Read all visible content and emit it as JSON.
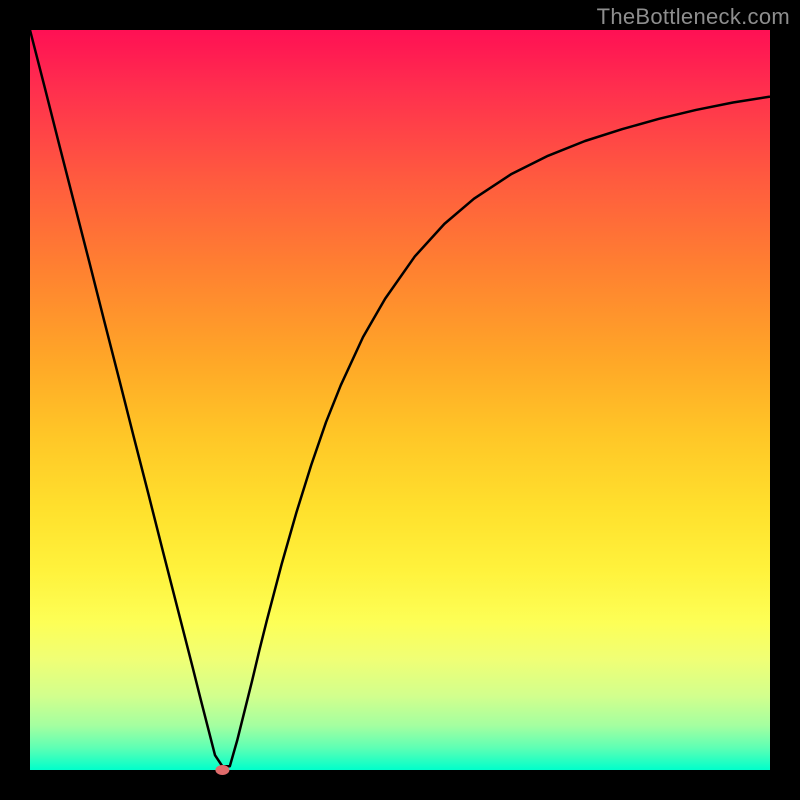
{
  "watermark": "TheBottleneck.com",
  "chart_data": {
    "type": "line",
    "title": "",
    "xlabel": "",
    "ylabel": "",
    "xlim": [
      0,
      100
    ],
    "ylim": [
      0,
      100
    ],
    "x": [
      0,
      2,
      4,
      6,
      8,
      10,
      12,
      14,
      16,
      18,
      20,
      22,
      23,
      24,
      25,
      26,
      27,
      28,
      29,
      30,
      31,
      32,
      33,
      34,
      36,
      38,
      40,
      42,
      45,
      48,
      52,
      56,
      60,
      65,
      70,
      75,
      80,
      85,
      90,
      95,
      100
    ],
    "y": [
      100,
      92.2,
      84.3,
      76.5,
      68.7,
      60.8,
      53.0,
      45.1,
      37.3,
      29.4,
      21.6,
      13.8,
      9.8,
      5.9,
      2.0,
      0.5,
      0.5,
      4.0,
      8.0,
      12.0,
      16.2,
      20.2,
      24.0,
      27.8,
      34.8,
      41.2,
      47.0,
      52.0,
      58.5,
      63.7,
      69.4,
      73.8,
      77.2,
      80.5,
      83.0,
      85.0,
      86.6,
      88.0,
      89.2,
      90.2,
      91.0
    ],
    "marker": {
      "x": 26.0,
      "y": 0.0
    },
    "background_gradient_top": "#ff1054",
    "background_gradient_bottom": "#00ffcb",
    "curve_color": "#000000",
    "marker_color": "#e06b6b"
  }
}
